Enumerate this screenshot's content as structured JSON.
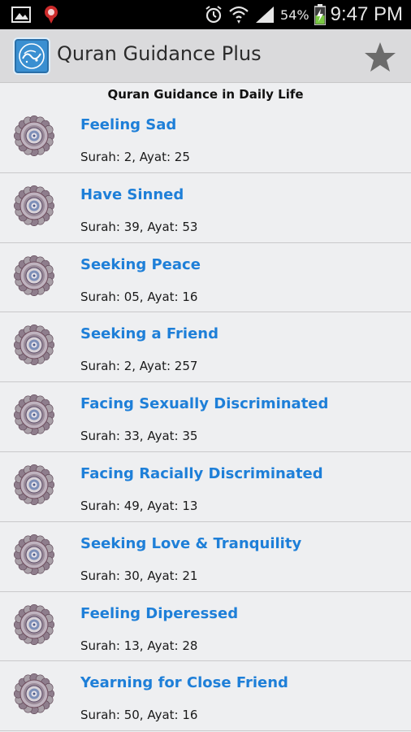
{
  "status_bar": {
    "battery_percent": "54%",
    "time": "9:47 PM",
    "icons": [
      "image-icon",
      "pin-icon",
      "alarm-icon",
      "wifi-icon",
      "signal-icon",
      "battery-charging-icon"
    ]
  },
  "action_bar": {
    "title": "Quran Guidance Plus",
    "logo_icon": "quran-logo-icon",
    "favorite_icon": "star-icon"
  },
  "section": {
    "header": "Quran Guidance in Daily Life"
  },
  "items": [
    {
      "title": "Feeling Sad",
      "reference": "Surah: 2, Ayat: 25"
    },
    {
      "title": "Have Sinned",
      "reference": "Surah: 39, Ayat: 53"
    },
    {
      "title": "Seeking Peace",
      "reference": "Surah: 05, Ayat: 16"
    },
    {
      "title": "Seeking a Friend",
      "reference": "Surah: 2, Ayat: 257"
    },
    {
      "title": "Facing Sexually Discriminated",
      "reference": "Surah: 33, Ayat: 35"
    },
    {
      "title": "Facing Racially Discriminated",
      "reference": "Surah: 49, Ayat: 13"
    },
    {
      "title": "Seeking Love & Tranquility",
      "reference": "Surah: 30, Ayat: 21"
    },
    {
      "title": "Feeling Diperessed",
      "reference": "Surah: 13, Ayat: 28"
    },
    {
      "title": "Yearning for Close Friend",
      "reference": "Surah: 50, Ayat: 16"
    }
  ],
  "colors": {
    "title_blue": "#1e7fd8",
    "background": "#eeeff1",
    "action_bar": "#dadadc",
    "status_bar": "#000000"
  }
}
